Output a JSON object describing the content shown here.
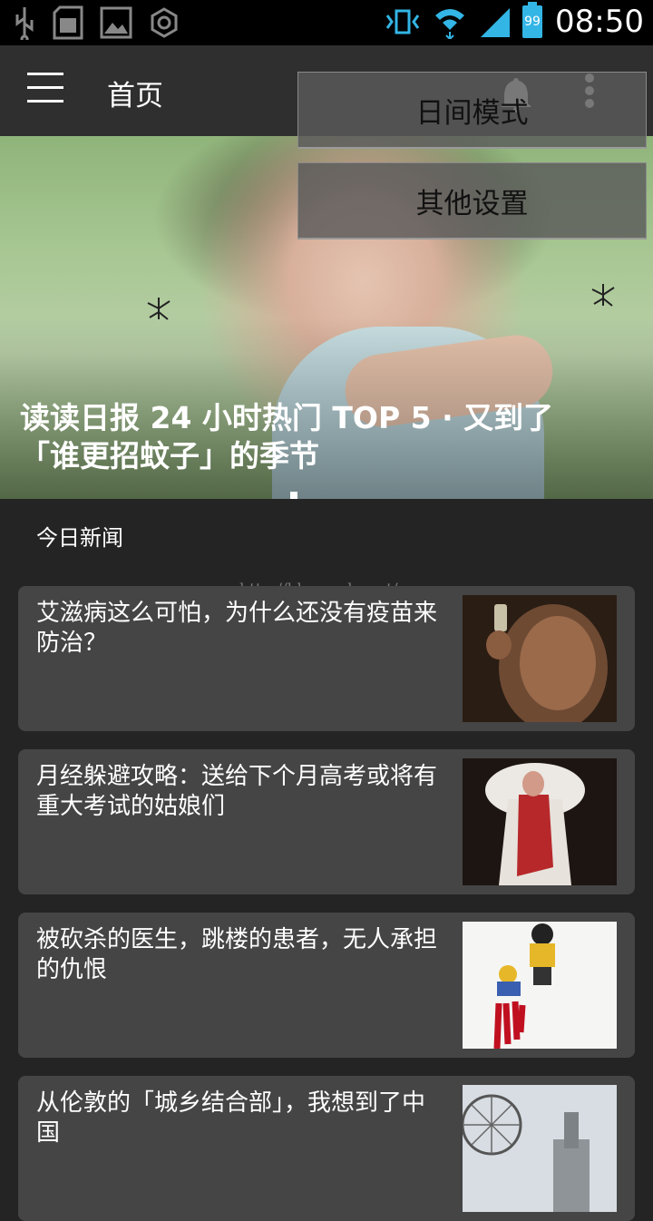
{
  "status_bar": {
    "time": "08:50",
    "battery": "99",
    "left_icons": [
      "usb-icon",
      "sd-card-icon",
      "image-icon",
      "sync-icon"
    ],
    "right_icons": [
      "vibrate-icon",
      "wifi-icon",
      "signal-icon",
      "battery-icon"
    ]
  },
  "app_bar": {
    "title": "首页",
    "icons": [
      "menu-icon",
      "bell-icon",
      "overflow-icon"
    ]
  },
  "popup_menu": {
    "items": [
      "日间模式",
      "其他设置"
    ]
  },
  "hero": {
    "title": "读读日报 24 小时热门 TOP 5 · 又到了「谁更招蚊子」的季节"
  },
  "section": {
    "label": "今日新闻"
  },
  "watermark": "http://blog.csdn.net/",
  "news": [
    {
      "title": "艾滋病这么可怕，为什么还没有疫苗来防治？"
    },
    {
      "title": "月经躲避攻略：送给下个月高考或将有重大考试的姑娘们"
    },
    {
      "title": "被砍杀的医生，跳楼的患者，无人承担的仇恨"
    },
    {
      "title": "从伦敦的「城乡结合部」，我想到了中国"
    }
  ],
  "colors": {
    "background": "#242424",
    "app_bar": "#2f2f2f",
    "card": "#454545",
    "status_accent": "#33b5e5"
  }
}
